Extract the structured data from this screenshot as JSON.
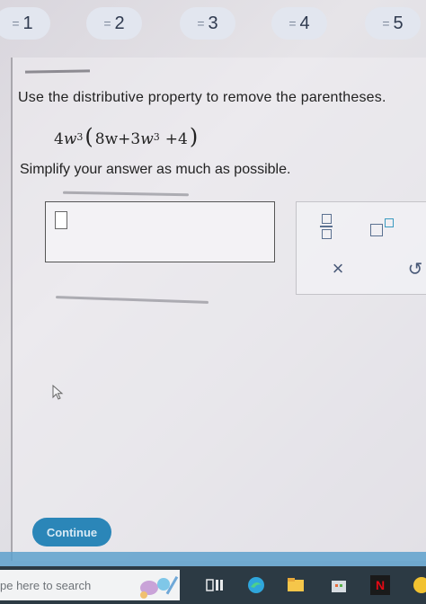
{
  "question_nav": [
    {
      "number": "1",
      "eq": "="
    },
    {
      "number": "2",
      "eq": "="
    },
    {
      "number": "3",
      "eq": "="
    },
    {
      "number": "4",
      "eq": "="
    },
    {
      "number": "5",
      "eq": "="
    }
  ],
  "question": {
    "prompt": "Use the distributive property to remove the parentheses.",
    "expression": {
      "coef": "4",
      "var": "w",
      "exp": "3",
      "inner_t1": "8w",
      "plus1": "+",
      "inner_t2_coef": "3",
      "inner_t2_var": "w",
      "inner_t2_exp": "3",
      "plus2": "+",
      "inner_t3": "4"
    },
    "instruction": "Simplify your answer as much as possible."
  },
  "tools": {
    "clear_symbol": "×",
    "undo_symbol": "↺"
  },
  "continue_label": "Continue",
  "taskbar": {
    "search_text": "pe here to search",
    "netflix_letter": "N"
  },
  "colors": {
    "accent": "#2b86b8",
    "pill_bg": "#e2e6ef",
    "taskbar": "#2c3a44"
  }
}
